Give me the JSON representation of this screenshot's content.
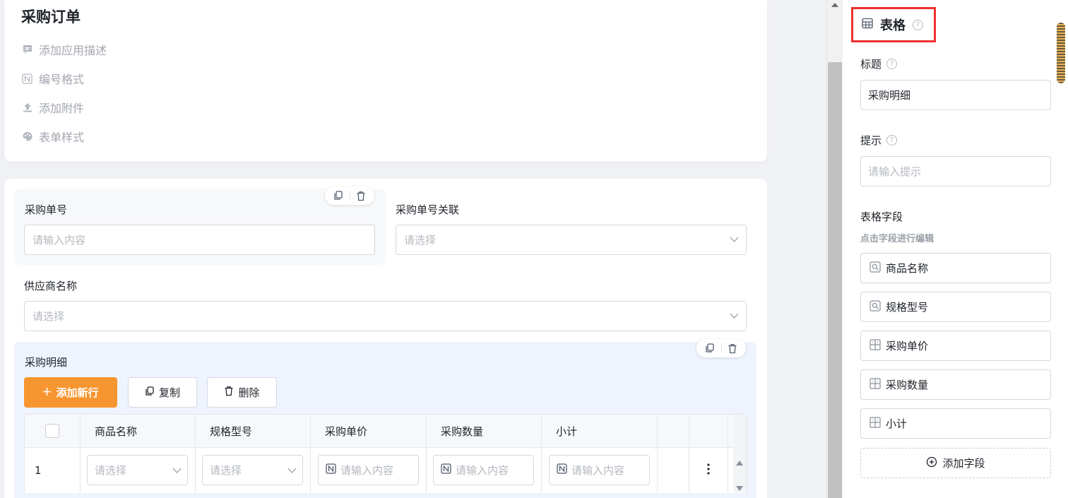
{
  "header": {
    "app_title": "采购订单",
    "actions": [
      {
        "label": "添加应用描述",
        "icon": "message-icon"
      },
      {
        "label": "编号格式",
        "icon": "numbering-icon"
      },
      {
        "label": "添加附件",
        "icon": "upload-icon"
      },
      {
        "label": "表单样式",
        "icon": "palette-icon"
      }
    ]
  },
  "form": {
    "fields": [
      {
        "label": "采购单号",
        "placeholder": "请输入内容"
      },
      {
        "label": "采购单号关联",
        "placeholder": "请选择"
      },
      {
        "label": "供应商名称",
        "placeholder": "请选择"
      }
    ],
    "table": {
      "title": "采购明细",
      "buttons": {
        "add_row": "添加新行",
        "copy": "复制",
        "delete": "删除"
      },
      "columns": [
        "商品名称",
        "规格型号",
        "采购单价",
        "采购数量",
        "小计"
      ],
      "rows": [
        {
          "index": "1",
          "cells": [
            "请选择",
            "请选择",
            "请输入内容",
            "请输入内容",
            "请输入内容"
          ]
        }
      ]
    }
  },
  "panel": {
    "title": "表格",
    "title_label": "标题",
    "title_value": "采购明细",
    "hint_label": "提示",
    "hint_placeholder": "请输入提示",
    "fields_label": "表格字段",
    "fields_sub": "点击字段进行编辑",
    "table_fields": [
      "商品名称",
      "规格型号",
      "采购单价",
      "采购数量",
      "小计"
    ],
    "add_field": "添加字段"
  },
  "colors": {
    "accent": "#f79631",
    "highlight_border": "#ee2f2f",
    "table_bg": "#eef3fe"
  }
}
